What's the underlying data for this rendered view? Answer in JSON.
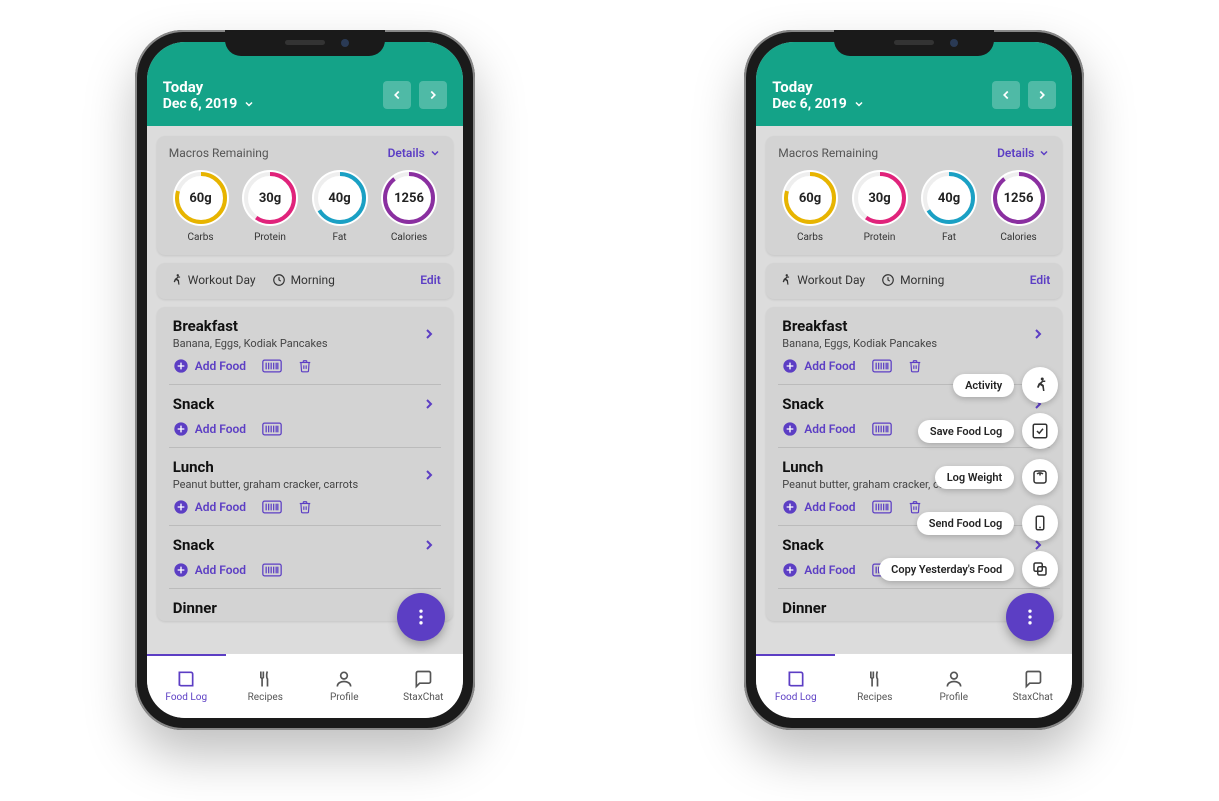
{
  "header": {
    "title": "Today",
    "date": "Dec 6, 2019"
  },
  "macros": {
    "section_label": "Macros Remaining",
    "details_label": "Details",
    "items": [
      {
        "value": "60g",
        "label": "Carbs",
        "color": "#e7b400"
      },
      {
        "value": "30g",
        "label": "Protein",
        "color": "#e0237b"
      },
      {
        "value": "40g",
        "label": "Fat",
        "color": "#1aa0c4"
      },
      {
        "value": "1256",
        "label": "Calories",
        "color": "#8a2fa0"
      }
    ]
  },
  "workout": {
    "day_label": "Workout Day",
    "time_label": "Morning",
    "edit_label": "Edit"
  },
  "add_food_label": "Add Food",
  "meals": [
    {
      "title": "Breakfast",
      "subtitle": "Banana, Eggs, Kodiak Pancakes",
      "show_trash": true
    },
    {
      "title": "Snack",
      "subtitle": "",
      "show_trash": false
    },
    {
      "title": "Lunch",
      "subtitle": "Peanut butter, graham cracker, carrots",
      "show_trash": true
    },
    {
      "title": "Snack",
      "subtitle": "",
      "show_trash": false
    },
    {
      "title": "Dinner",
      "subtitle": "",
      "show_trash": false
    }
  ],
  "bottom_nav": [
    {
      "label": "Food Log",
      "active": true
    },
    {
      "label": "Recipes",
      "active": false
    },
    {
      "label": "Profile",
      "active": false
    },
    {
      "label": "StaxChat",
      "active": false
    }
  ],
  "fab_menu": [
    {
      "label": "Activity"
    },
    {
      "label": "Save Food Log"
    },
    {
      "label": "Log Weight"
    },
    {
      "label": "Send Food Log"
    },
    {
      "label": "Copy Yesterday's Food"
    }
  ]
}
